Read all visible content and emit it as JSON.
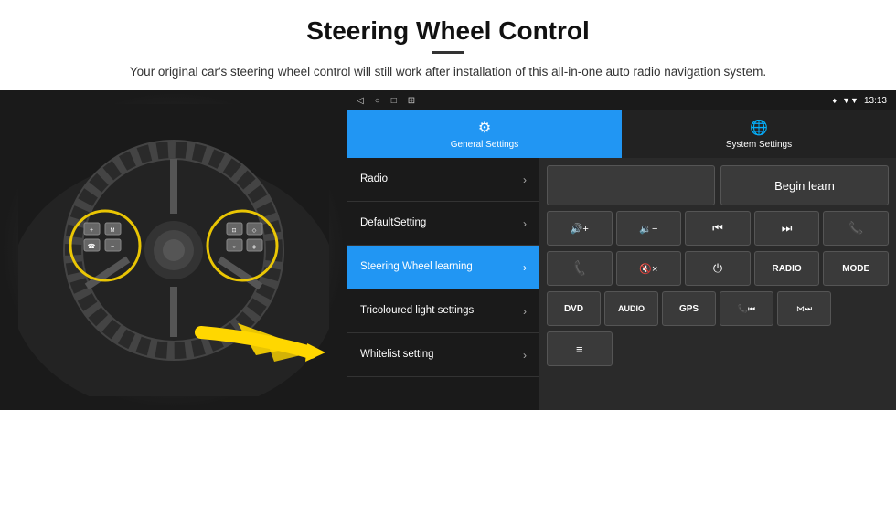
{
  "header": {
    "title": "Steering Wheel Control",
    "subtitle": "Your original car's steering wheel control will still work after installation of this all-in-one auto radio navigation system."
  },
  "status_bar": {
    "back_icon": "◁",
    "home_icon": "○",
    "square_icon": "□",
    "grid_icon": "⊞",
    "time": "13:13",
    "location_icon": "♦",
    "wifi_icon": "▼"
  },
  "tabs": [
    {
      "id": "general",
      "label": "General Settings",
      "icon": "⚙",
      "active": true
    },
    {
      "id": "system",
      "label": "System Settings",
      "icon": "🌐",
      "active": false
    }
  ],
  "menu_items": [
    {
      "id": "radio",
      "label": "Radio",
      "active": false
    },
    {
      "id": "default",
      "label": "DefaultSetting",
      "active": false
    },
    {
      "id": "steering",
      "label": "Steering Wheel learning",
      "active": true
    },
    {
      "id": "tricoloured",
      "label": "Tricoloured light settings",
      "active": false
    },
    {
      "id": "whitelist",
      "label": "Whitelist setting",
      "active": false
    }
  ],
  "begin_learn_label": "Begin learn",
  "icon_grid_row1": [
    {
      "id": "vol-up",
      "symbol": "◄+",
      "label": "vol-up"
    },
    {
      "id": "vol-down",
      "symbol": "◄−",
      "label": "vol-down"
    },
    {
      "id": "prev-track",
      "symbol": "⏮",
      "label": "prev-track"
    },
    {
      "id": "next-track",
      "symbol": "⏭",
      "label": "next-track"
    },
    {
      "id": "phone",
      "symbol": "✆",
      "label": "phone"
    }
  ],
  "icon_grid_row2": [
    {
      "id": "answer",
      "symbol": "✆",
      "label": "answer-call"
    },
    {
      "id": "mute",
      "symbol": "🔇×",
      "label": "mute"
    },
    {
      "id": "power",
      "symbol": "⏻",
      "label": "power"
    },
    {
      "id": "radio-btn",
      "symbol": "RADIO",
      "label": "radio-btn",
      "is_text": true
    },
    {
      "id": "mode",
      "symbol": "MODE",
      "label": "mode-btn",
      "is_text": true
    }
  ],
  "icon_grid_row3": [
    {
      "id": "dvd",
      "symbol": "DVD",
      "label": "dvd-btn",
      "is_text": true
    },
    {
      "id": "audio",
      "symbol": "AUDIO",
      "label": "audio-btn",
      "is_text": true
    },
    {
      "id": "gps",
      "symbol": "GPS",
      "label": "gps-btn",
      "is_text": true
    },
    {
      "id": "phone2",
      "symbol": "✆⏮",
      "label": "phone-prev"
    },
    {
      "id": "combo1",
      "symbol": "⋈⏭",
      "label": "combo-next"
    }
  ],
  "icon_grid_row4": [
    {
      "id": "list",
      "symbol": "≡",
      "label": "list-icon"
    }
  ]
}
